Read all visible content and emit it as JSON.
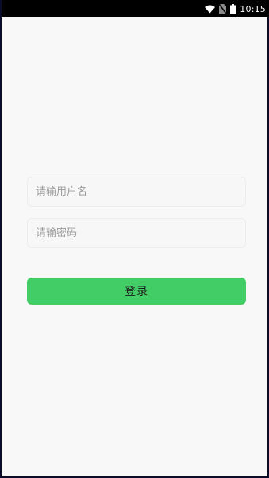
{
  "status_bar": {
    "time": "10:15",
    "icons": [
      "wifi-icon",
      "no-sim-icon",
      "battery-icon"
    ]
  },
  "login_form": {
    "username_placeholder": "请输用户名",
    "username_value": "",
    "password_placeholder": "请输密码",
    "password_value": "",
    "submit_label": "登录"
  },
  "colors": {
    "accent": "#43cd66",
    "background": "#f8f8f8",
    "status_bar": "#000000"
  }
}
